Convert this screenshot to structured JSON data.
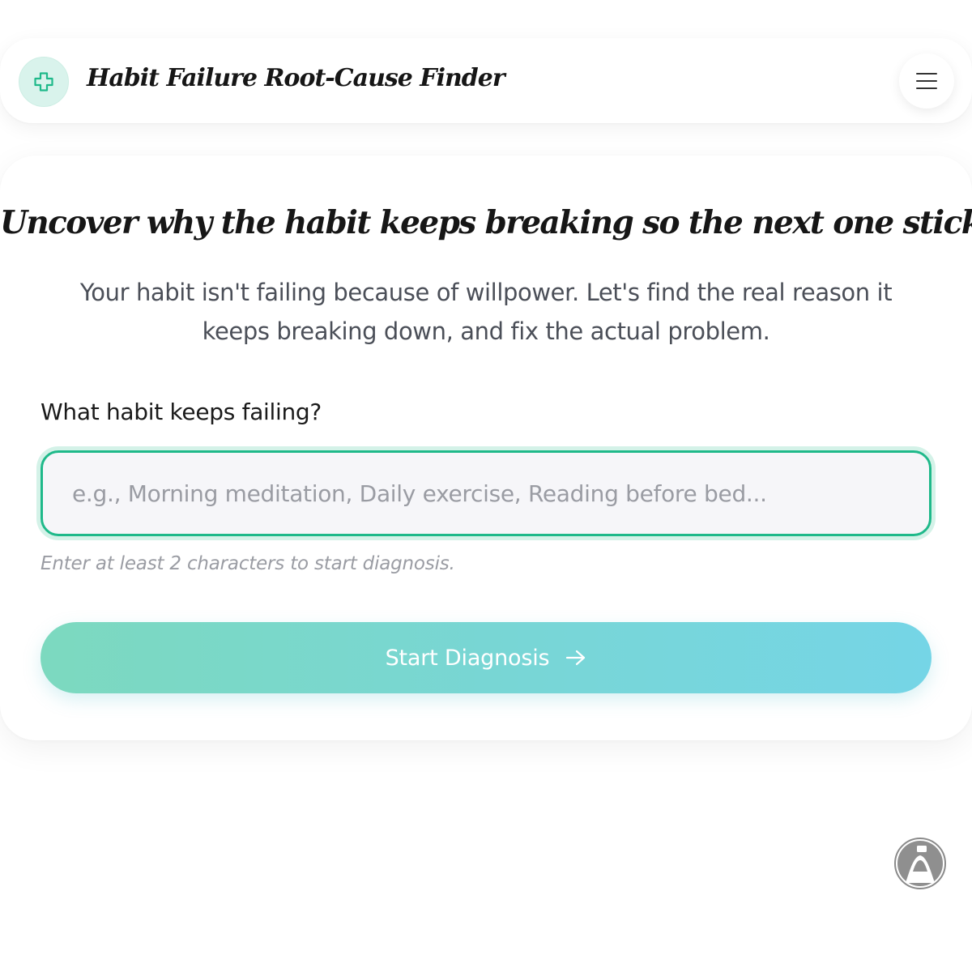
{
  "header": {
    "title": "Habit Failure Root-Cause Finder",
    "logo_icon": "medical-cross-icon",
    "menu_icon": "hamburger-menu-icon"
  },
  "hero": {
    "headline": "Uncover why the habit keeps breaking so the next one sticks",
    "subtitle": "Your habit isn't failing because of willpower. Let's find the real reason it keeps breaking down, and fix the actual problem."
  },
  "form": {
    "label": "What habit keeps failing?",
    "input_value": "",
    "input_placeholder": "e.g., Morning meditation, Daily exercise, Reading before bed...",
    "hint": "Enter at least 2 characters to start diagnosis.",
    "submit_label": "Start Diagnosis",
    "submit_icon": "arrow-right-icon"
  },
  "floating": {
    "avatar_icon": "user-avatar-icon"
  },
  "colors": {
    "accent": "#1fb98a",
    "logo_bg": "#d9f3ec",
    "button_gradient_start": "#7cd9bf",
    "button_gradient_end": "#75d5e6",
    "text_primary": "#161616",
    "text_secondary": "#4b4f58",
    "text_muted": "#9a9ca3",
    "input_bg": "#f6f6f9"
  }
}
